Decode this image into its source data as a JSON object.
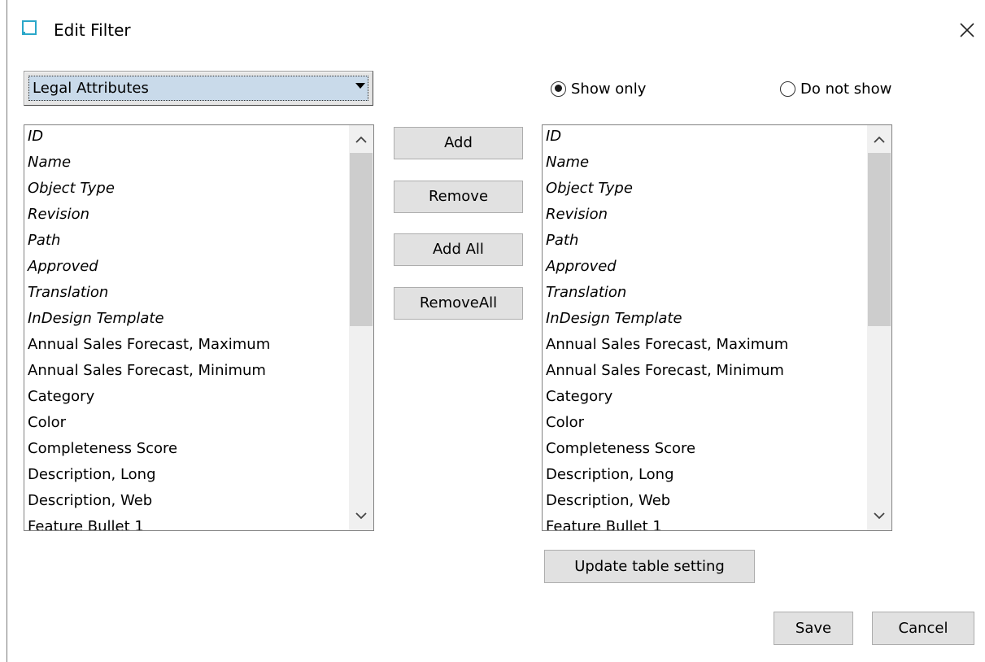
{
  "window": {
    "title": "Edit Filter"
  },
  "source": {
    "dropdown_value": "Legal Attributes",
    "items": [
      {
        "label": "ID",
        "italic": true
      },
      {
        "label": "Name",
        "italic": true
      },
      {
        "label": "Object Type",
        "italic": true
      },
      {
        "label": "Revision",
        "italic": true
      },
      {
        "label": "Path",
        "italic": true
      },
      {
        "label": "Approved",
        "italic": true
      },
      {
        "label": "Translation",
        "italic": true
      },
      {
        "label": "InDesign Template",
        "italic": true
      },
      {
        "label": "Annual Sales Forecast, Maximum",
        "italic": false
      },
      {
        "label": "Annual Sales Forecast, Minimum",
        "italic": false
      },
      {
        "label": "Category",
        "italic": false
      },
      {
        "label": "Color",
        "italic": false
      },
      {
        "label": "Completeness Score",
        "italic": false
      },
      {
        "label": "Description, Long",
        "italic": false
      },
      {
        "label": "Description, Web",
        "italic": false
      },
      {
        "label": "Feature Bullet 1",
        "italic": false
      }
    ]
  },
  "mode": {
    "show_only_label": "Show only",
    "do_not_show_label": "Do not show",
    "selected": "show_only"
  },
  "actions": {
    "add": "Add",
    "remove": "Remove",
    "add_all": "Add All",
    "remove_all": "RemoveAll"
  },
  "target": {
    "items": [
      {
        "label": "ID",
        "italic": true
      },
      {
        "label": "Name",
        "italic": true
      },
      {
        "label": "Object Type",
        "italic": true
      },
      {
        "label": "Revision",
        "italic": true
      },
      {
        "label": "Path",
        "italic": true
      },
      {
        "label": "Approved",
        "italic": true
      },
      {
        "label": "Translation",
        "italic": true
      },
      {
        "label": "InDesign Template",
        "italic": true
      },
      {
        "label": "Annual Sales Forecast, Maximum",
        "italic": false
      },
      {
        "label": "Annual Sales Forecast, Minimum",
        "italic": false
      },
      {
        "label": "Category",
        "italic": false
      },
      {
        "label": "Color",
        "italic": false
      },
      {
        "label": "Completeness Score",
        "italic": false
      },
      {
        "label": "Description, Long",
        "italic": false
      },
      {
        "label": "Description, Web",
        "italic": false
      },
      {
        "label": "Feature Bullet 1",
        "italic": false
      }
    ],
    "update_label": "Update table setting"
  },
  "footer": {
    "save": "Save",
    "cancel": "Cancel"
  },
  "icons": {
    "app": "window-icon",
    "close": "close-icon",
    "dropdown": "dropdown-arrow-icon",
    "scroll_up": "chevron-up-icon",
    "scroll_down": "chevron-down-icon"
  },
  "colors": {
    "app_icon": "#2aa7c9",
    "dropdown_selected_bg": "#c9daea",
    "button_bg": "#e1e1e1",
    "scroll_thumb": "#cdcdcd"
  }
}
